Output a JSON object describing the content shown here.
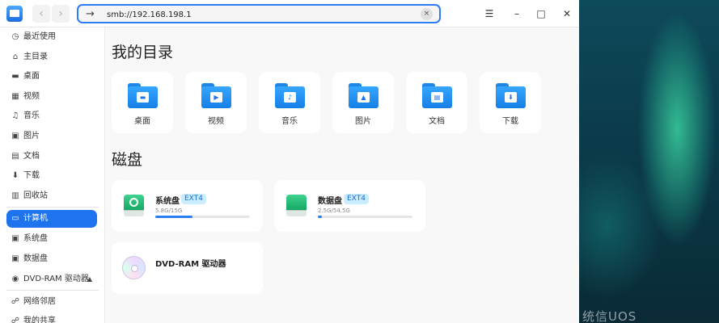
{
  "address": {
    "value": "smb://192.168.198.1"
  },
  "sidebar": {
    "items": [
      {
        "icon": "clock-icon",
        "glyph": "◷",
        "label": "最近使用"
      },
      {
        "icon": "home-icon",
        "glyph": "⌂",
        "label": "主目录"
      },
      {
        "icon": "desktop-icon",
        "glyph": "▬",
        "label": "桌面"
      },
      {
        "icon": "video-icon",
        "glyph": "▦",
        "label": "视频"
      },
      {
        "icon": "music-icon",
        "glyph": "♫",
        "label": "音乐"
      },
      {
        "icon": "picture-icon",
        "glyph": "▣",
        "label": "图片"
      },
      {
        "icon": "document-icon",
        "glyph": "▤",
        "label": "文档"
      },
      {
        "icon": "download-icon",
        "glyph": "⬇",
        "label": "下载"
      },
      {
        "icon": "trash-icon",
        "glyph": "▥",
        "label": "回收站"
      },
      {
        "icon": "computer-icon",
        "glyph": "▭",
        "label": "计算机"
      },
      {
        "icon": "disk-icon",
        "glyph": "▣",
        "label": "系统盘"
      },
      {
        "icon": "disk-icon",
        "glyph": "▣",
        "label": "数据盘"
      },
      {
        "icon": "cdrom-icon",
        "glyph": "◉",
        "label": "DVD-RAM 驱动器"
      },
      {
        "icon": "network-icon",
        "glyph": "☍",
        "label": "网络邻居"
      },
      {
        "icon": "share-icon",
        "glyph": "☍",
        "label": "我的共享"
      }
    ],
    "active_index": 9
  },
  "main": {
    "directories_title": "我的目录",
    "folders": [
      {
        "label": "桌面",
        "icon": "desktop-folder-icon",
        "glyph": "▬"
      },
      {
        "label": "视频",
        "icon": "video-folder-icon",
        "glyph": "▶"
      },
      {
        "label": "音乐",
        "icon": "music-folder-icon",
        "glyph": "♪"
      },
      {
        "label": "图片",
        "icon": "picture-folder-icon",
        "glyph": "▲"
      },
      {
        "label": "文档",
        "icon": "document-folder-icon",
        "glyph": "▤"
      },
      {
        "label": "下载",
        "icon": "download-folder-icon",
        "glyph": "⬇"
      }
    ],
    "disks_title": "磁盘",
    "disks": [
      {
        "name": "系统盘",
        "fs": "EXT4",
        "usage": "5.8G/15G",
        "used_fraction": 0.39
      },
      {
        "name": "数据盘",
        "fs": "EXT4",
        "usage": "2.5G/54.5G",
        "used_fraction": 0.046
      }
    ],
    "optical": {
      "name": "DVD-RAM 驱动器"
    }
  },
  "wallpaper": {
    "brand": "统信UOS"
  },
  "colors": {
    "accent": "#1f73ee",
    "folder": "#2a95f5",
    "disk": "#22b873"
  }
}
